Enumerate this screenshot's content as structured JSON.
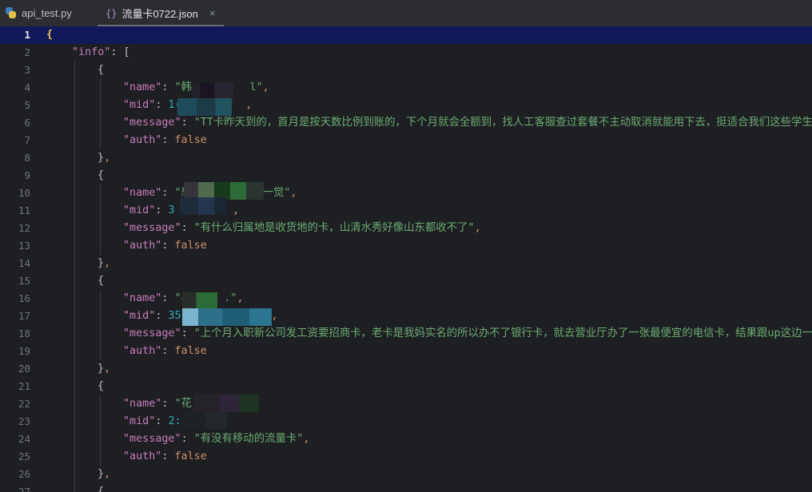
{
  "tabs": [
    {
      "label": "api_test.py",
      "icon": "python-icon",
      "active": false
    },
    {
      "label": "流量卡0722.json",
      "icon": "json-braces-icon",
      "active": true,
      "close": "×"
    }
  ],
  "editor": {
    "current_line": 1,
    "lines": [
      {
        "n": "1",
        "indent": 0,
        "tokens": [
          {
            "t": "{",
            "c": "brace-hl"
          }
        ]
      },
      {
        "n": "2",
        "indent": 1,
        "tokens": [
          {
            "t": "\"info\"",
            "c": "k"
          },
          {
            "t": ": [",
            "c": "p"
          }
        ]
      },
      {
        "n": "3",
        "indent": 2,
        "tokens": [
          {
            "t": "{",
            "c": "p"
          }
        ]
      },
      {
        "n": "4",
        "indent": 3,
        "tokens": [
          {
            "t": "\"name\"",
            "c": "k"
          },
          {
            "t": ": ",
            "c": "p"
          },
          {
            "t": "\"韩         l\"",
            "c": "s"
          },
          {
            "t": ",",
            "c": "b"
          }
        ]
      },
      {
        "n": "5",
        "indent": 3,
        "tokens": [
          {
            "t": "\"mid\"",
            "c": "k"
          },
          {
            "t": ": ",
            "c": "p"
          },
          {
            "t": "1(          ",
            "c": "n"
          },
          {
            "t": ",",
            "c": "b"
          }
        ]
      },
      {
        "n": "6",
        "indent": 3,
        "tokens": [
          {
            "t": "\"message\"",
            "c": "k"
          },
          {
            "t": ": ",
            "c": "p"
          },
          {
            "t": "\"TT卡昨天到的，首月是按天数比例到账的，下个月就会全额到，找人工客服查过套餐不主动取消就能用下去，挺适合我们这些学生党的",
            "c": "s"
          }
        ]
      },
      {
        "n": "7",
        "indent": 3,
        "tokens": [
          {
            "t": "\"auth\"",
            "c": "k"
          },
          {
            "t": ": ",
            "c": "p"
          },
          {
            "t": "false",
            "c": "b"
          }
        ]
      },
      {
        "n": "8",
        "indent": 2,
        "tokens": [
          {
            "t": "}",
            "c": "p"
          },
          {
            "t": ",",
            "c": "b"
          }
        ]
      },
      {
        "n": "9",
        "indent": 2,
        "tokens": [
          {
            "t": "{",
            "c": "p"
          }
        ]
      },
      {
        "n": "10",
        "indent": 3,
        "tokens": [
          {
            "t": "\"name\"",
            "c": "k"
          },
          {
            "t": ": ",
            "c": "p"
          },
          {
            "t": "\"想           一觉\"",
            "c": "s"
          },
          {
            "t": ",",
            "c": "b"
          }
        ]
      },
      {
        "n": "11",
        "indent": 3,
        "tokens": [
          {
            "t": "\"mid\"",
            "c": "k"
          },
          {
            "t": ": ",
            "c": "p"
          },
          {
            "t": "3         ",
            "c": "n"
          },
          {
            "t": ",",
            "c": "b"
          }
        ]
      },
      {
        "n": "12",
        "indent": 3,
        "tokens": [
          {
            "t": "\"message\"",
            "c": "k"
          },
          {
            "t": ": ",
            "c": "p"
          },
          {
            "t": "\"有什么归属地是收货地的卡，山清水秀好像山东都收不了\"",
            "c": "s"
          },
          {
            "t": ",",
            "c": "b"
          }
        ]
      },
      {
        "n": "13",
        "indent": 3,
        "tokens": [
          {
            "t": "\"auth\"",
            "c": "k"
          },
          {
            "t": ": ",
            "c": "p"
          },
          {
            "t": "false",
            "c": "b"
          }
        ]
      },
      {
        "n": "14",
        "indent": 2,
        "tokens": [
          {
            "t": "}",
            "c": "p"
          },
          {
            "t": ",",
            "c": "b"
          }
        ]
      },
      {
        "n": "15",
        "indent": 2,
        "tokens": [
          {
            "t": "{",
            "c": "p"
          }
        ]
      },
      {
        "n": "16",
        "indent": 3,
        "tokens": [
          {
            "t": "\"name\"",
            "c": "k"
          },
          {
            "t": ": ",
            "c": "p"
          },
          {
            "t": "\"小     .\"",
            "c": "s"
          },
          {
            "t": ",",
            "c": "b"
          }
        ]
      },
      {
        "n": "17",
        "indent": 3,
        "tokens": [
          {
            "t": "\"mid\"",
            "c": "k"
          },
          {
            "t": ": ",
            "c": "p"
          },
          {
            "t": "35              ",
            "c": "n"
          },
          {
            "t": ",",
            "c": "b"
          }
        ]
      },
      {
        "n": "18",
        "indent": 3,
        "tokens": [
          {
            "t": "\"message\"",
            "c": "k"
          },
          {
            "t": ": ",
            "c": "p"
          },
          {
            "t": "\"上个月入职新公司发工资要招商卡，老卡是我妈实名的所以办不了银行卡，就去营业厅办了一张最便宜的电信卡，结果跟up这边一样显",
            "c": "s"
          }
        ]
      },
      {
        "n": "19",
        "indent": 3,
        "tokens": [
          {
            "t": "\"auth\"",
            "c": "k"
          },
          {
            "t": ": ",
            "c": "p"
          },
          {
            "t": "false",
            "c": "b"
          }
        ]
      },
      {
        "n": "20",
        "indent": 2,
        "tokens": [
          {
            "t": "}",
            "c": "p"
          },
          {
            "t": ",",
            "c": "b"
          }
        ]
      },
      {
        "n": "21",
        "indent": 2,
        "tokens": [
          {
            "t": "{",
            "c": "p"
          }
        ]
      },
      {
        "n": "22",
        "indent": 3,
        "tokens": [
          {
            "t": "\"name\"",
            "c": "k"
          },
          {
            "t": ": ",
            "c": "p"
          },
          {
            "t": "\"花         ",
            "c": "s"
          },
          {
            "t": ",",
            "c": "b"
          }
        ]
      },
      {
        "n": "23",
        "indent": 3,
        "tokens": [
          {
            "t": "\"mid\"",
            "c": "k"
          },
          {
            "t": ": ",
            "c": "p"
          },
          {
            "t": "2:",
            "c": "n"
          }
        ]
      },
      {
        "n": "24",
        "indent": 3,
        "tokens": [
          {
            "t": "\"message\"",
            "c": "k"
          },
          {
            "t": ": ",
            "c": "p"
          },
          {
            "t": "\"有没有移动的流量卡\"",
            "c": "s"
          },
          {
            "t": ",",
            "c": "b"
          }
        ]
      },
      {
        "n": "25",
        "indent": 3,
        "tokens": [
          {
            "t": "\"auth\"",
            "c": "k"
          },
          {
            "t": ": ",
            "c": "p"
          },
          {
            "t": "false",
            "c": "b"
          }
        ]
      },
      {
        "n": "26",
        "indent": 2,
        "tokens": [
          {
            "t": "}",
            "c": "p"
          },
          {
            "t": ",",
            "c": "b"
          }
        ]
      },
      {
        "n": "27",
        "indent": 2,
        "tokens": [
          {
            "t": "{",
            "c": "p"
          }
        ]
      }
    ]
  }
}
